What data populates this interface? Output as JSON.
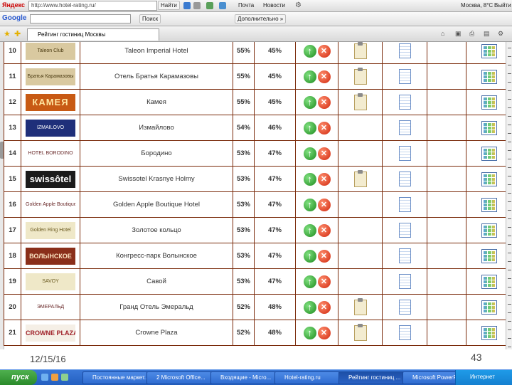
{
  "toolbar": {
    "search_engine": "Яндекс",
    "url": "http://www.hotel-rating.ru/",
    "find_button": "Найти",
    "mail_button": "Почта",
    "news_button": "Новости",
    "weather": "Москва, 8°C",
    "logout": "Выйти"
  },
  "googlebar": {
    "logo": "Google",
    "search_button": "Поиск",
    "more_button": "Дополнительно »"
  },
  "tab": {
    "title": "Рейтинг гостиниц Москвы"
  },
  "hotels": [
    {
      "num": "10",
      "logo": "Taleon Club",
      "logo_style": "tan",
      "name": "Taleon Imperial Hotel",
      "pct1": "55%",
      "pct2": "45%",
      "clip": true,
      "pdf": false,
      "star": false
    },
    {
      "num": "11",
      "logo": "Братья Карамазовы",
      "logo_style": "tan",
      "name": "Отель Братья Карамазовы",
      "pct1": "55%",
      "pct2": "45%",
      "clip": true,
      "pdf": false,
      "star": false
    },
    {
      "num": "12",
      "logo": "КАМЕЯ",
      "logo_style": "orange",
      "name": "Камея",
      "pct1": "55%",
      "pct2": "45%",
      "clip": true,
      "pdf": false,
      "star": false
    },
    {
      "num": "13",
      "logo": "IZMAILOVO",
      "logo_style": "navy",
      "name": "Измайлово",
      "pct1": "54%",
      "pct2": "46%",
      "clip": false,
      "pdf": false,
      "star": false
    },
    {
      "num": "14",
      "logo": "HOTEL BORODINO",
      "logo_style": "plain",
      "name": "Бородино",
      "pct1": "53%",
      "pct2": "47%",
      "clip": false,
      "pdf": false,
      "star": false
    },
    {
      "num": "15",
      "logo": "swissôtel",
      "logo_style": "dark",
      "name": "Swissotel Krasnye Holmy",
      "pct1": "53%",
      "pct2": "47%",
      "clip": true,
      "pdf": true,
      "star": false
    },
    {
      "num": "16",
      "logo": "Golden Apple Boutique Hotel",
      "logo_style": "plain",
      "name": "Golden Apple Boutique Hotel",
      "pct1": "53%",
      "pct2": "47%",
      "clip": false,
      "pdf": false,
      "star": false
    },
    {
      "num": "17",
      "logo": "Golden Ring Hotel",
      "logo_style": "cream",
      "name": "Золотое кольцо",
      "pct1": "53%",
      "pct2": "47%",
      "clip": false,
      "pdf": false,
      "star": false
    },
    {
      "num": "18",
      "logo": "ВОЛЫНСКОЕ",
      "logo_style": "red",
      "name": "Конгресс-парк Волынское",
      "pct1": "53%",
      "pct2": "47%",
      "clip": false,
      "pdf": true,
      "star": false
    },
    {
      "num": "19",
      "logo": "SAVOY",
      "logo_style": "cream",
      "name": "Савой",
      "pct1": "53%",
      "pct2": "47%",
      "clip": false,
      "pdf": false,
      "star": true
    },
    {
      "num": "20",
      "logo": "ЭМЕРАЛЬД",
      "logo_style": "plain",
      "name": "Гранд Отель Эмеральд",
      "pct1": "52%",
      "pct2": "48%",
      "clip": true,
      "pdf": false,
      "star": false
    },
    {
      "num": "21",
      "logo": "CROWNE PLAZA",
      "logo_style": "crowne",
      "name": "Crowne Plaza",
      "pct1": "52%",
      "pct2": "48%",
      "clip": true,
      "pdf": false,
      "star": false
    }
  ],
  "slide": {
    "date": "12/15/16",
    "page_number": "43"
  },
  "taskbar": {
    "start_label": "пуск",
    "tasks": [
      "Постоянные маркет...",
      "2 Microsoft Office...",
      "Входящие - Micro...",
      "Hotel-rating.ru",
      "Рейтинг гостиниц ...",
      "Microsoft PowerPoint..."
    ],
    "clock": "Интернет"
  }
}
